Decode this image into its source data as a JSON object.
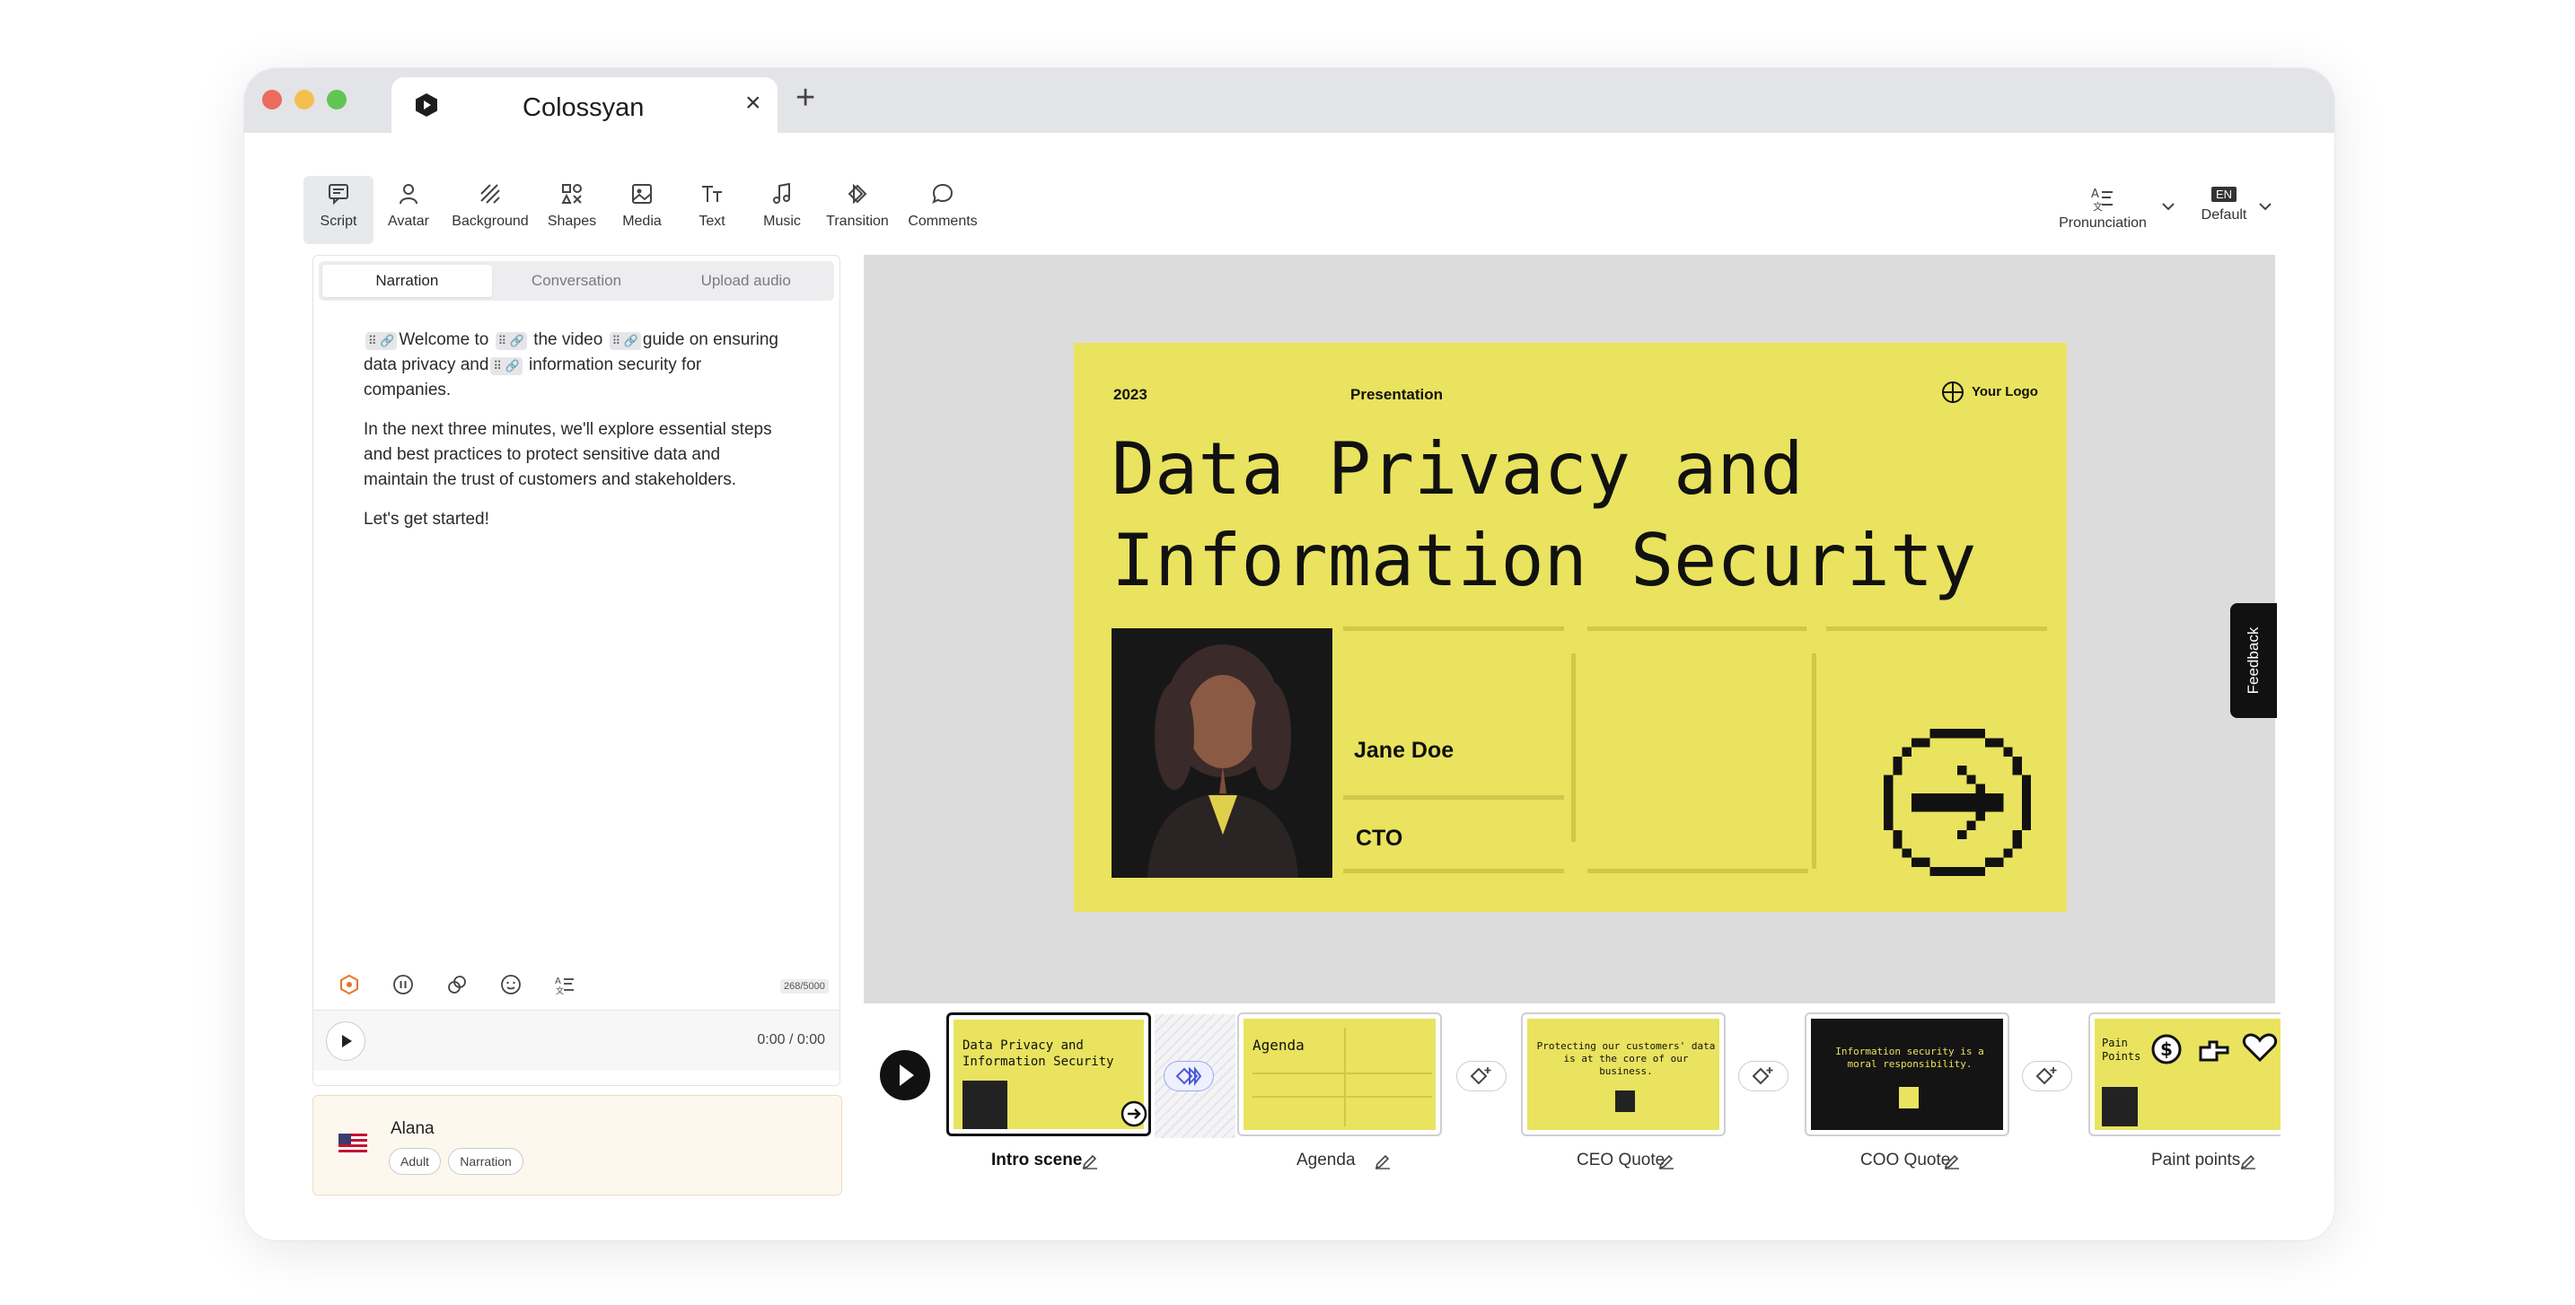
{
  "browser": {
    "tab_title": "Colossyan",
    "tab_close": "×",
    "new_tab": "+"
  },
  "toolbar": {
    "items": [
      {
        "label": "Script",
        "icon": "script-icon"
      },
      {
        "label": "Avatar",
        "icon": "avatar-icon"
      },
      {
        "label": "Background",
        "icon": "background-icon"
      },
      {
        "label": "Shapes",
        "icon": "shapes-icon"
      },
      {
        "label": "Media",
        "icon": "media-icon"
      },
      {
        "label": "Text",
        "icon": "text-icon"
      },
      {
        "label": "Music",
        "icon": "music-icon"
      },
      {
        "label": "Transition",
        "icon": "transition-icon"
      },
      {
        "label": "Comments",
        "icon": "comments-icon"
      }
    ],
    "pronunciation": "Pronunciation",
    "language_badge": "EN",
    "language_value": "Default"
  },
  "script": {
    "tabs": [
      "Narration",
      "Conversation",
      "Upload audio"
    ],
    "active_tab": "Narration",
    "pause_glyph": "⠿ 🔗",
    "p1_a": "Welcome to",
    "p1_b": "the video",
    "p1_c": "guide on ensuring data privacy and",
    "p1_d": "information security for companies.",
    "p2": "In the next three minutes, we'll explore essential steps and best practices to protect sensitive data and maintain the trust of customers and stakeholders.",
    "p3": "Let's get started!",
    "char_count": "268/5000",
    "time": "0:00 / 0:00"
  },
  "avatar": {
    "name": "Alana",
    "tags": [
      "Adult",
      "Narration"
    ]
  },
  "slide": {
    "year": "2023",
    "kind": "Presentation",
    "logo": "Your Logo",
    "title_line1": "Data Privacy and",
    "title_line2": "Information Security",
    "person_name": "Jane Doe",
    "person_role": "CTO",
    "bg_color": "#e9e35f"
  },
  "feedback": "Feedback",
  "scenes": [
    {
      "label": "Intro scene",
      "thumb_title": "Data Privacy and Information Security",
      "selected": true
    },
    {
      "label": "Agenda",
      "thumb_title": "Agenda",
      "selected": false
    },
    {
      "label": "CEO Quote",
      "thumb_title": "Protecting our customers' data is at the core of our business.",
      "selected": false
    },
    {
      "label": "COO Quote",
      "thumb_title": "Information security is a moral responsibility.",
      "selected": false
    },
    {
      "label": "Paint points",
      "thumb_title": "Pain Points",
      "selected": false
    }
  ]
}
